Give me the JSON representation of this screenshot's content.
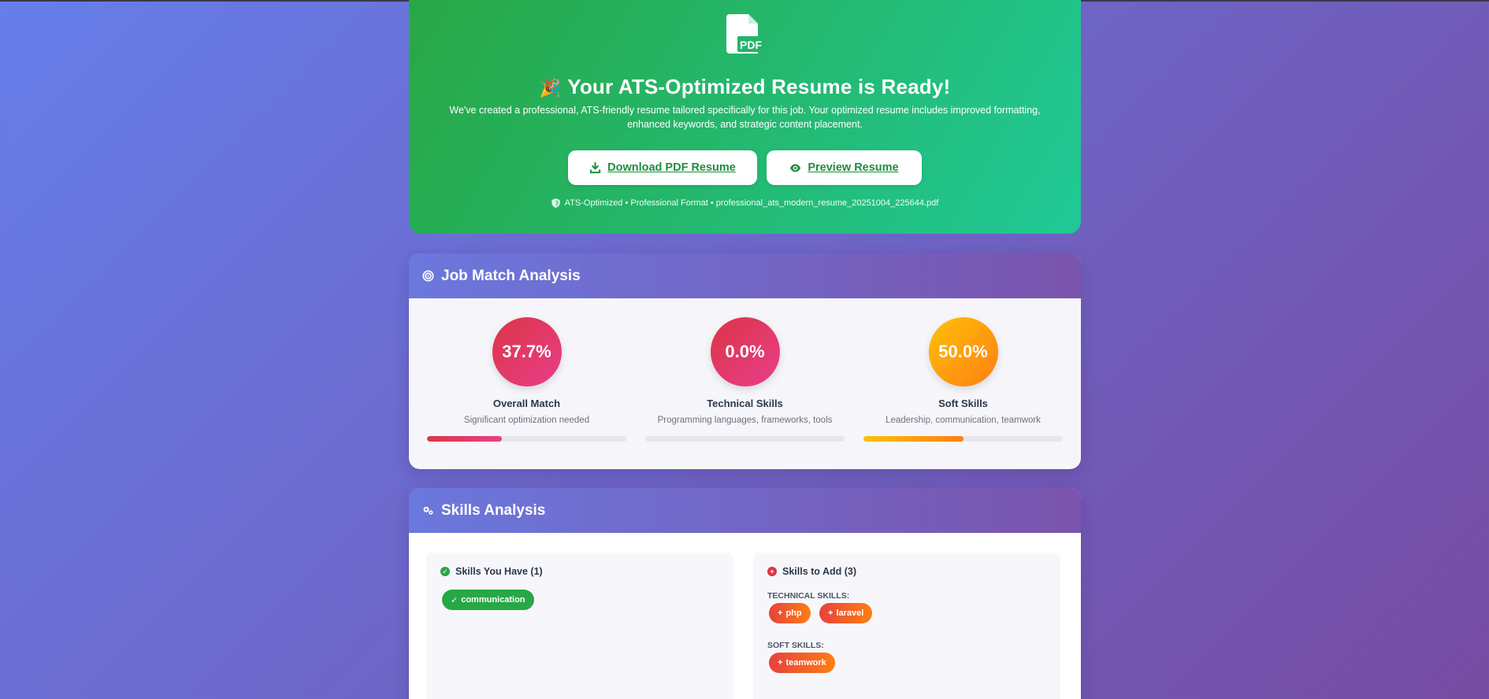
{
  "hero": {
    "icon": "pdf-file-icon",
    "icon_text": "PDF",
    "title_emoji": "🎉",
    "title": "Your ATS-Optimized Resume is Ready!",
    "description": "We've created a professional, ATS-friendly resume tailored specifically for this job. Your optimized resume includes improved formatting, enhanced keywords, and strategic content placement.",
    "download_label": "Download PDF Resume",
    "preview_label": "Preview Resume",
    "meta": "ATS-Optimized • Professional Format • professional_ats_modern_resume_20251004_225644.pdf"
  },
  "job_match": {
    "title": "Job Match Analysis",
    "icon": "target-icon",
    "metrics": [
      {
        "value": "37.7%",
        "percent": 37.7,
        "label": "Overall Match",
        "description": "Significant optimization needed",
        "level": "low"
      },
      {
        "value": "0.0%",
        "percent": 0.0,
        "label": "Technical Skills",
        "description": "Programming languages, frameworks, tools",
        "level": "low"
      },
      {
        "value": "50.0%",
        "percent": 50.0,
        "label": "Soft Skills",
        "description": "Leadership, communication, teamwork",
        "level": "mid"
      }
    ]
  },
  "skills": {
    "title": "Skills Analysis",
    "icon": "cogs-icon",
    "have_title": "Skills You Have (1)",
    "have": [
      "communication"
    ],
    "add_title": "Skills to Add (3)",
    "technical_label": "TECHNICAL SKILLS:",
    "technical": [
      "php",
      "laravel"
    ],
    "soft_label": "SOFT SKILLS:",
    "soft": [
      "teamwork"
    ]
  },
  "colors": {
    "success_green": "#28a745",
    "teal": "#20c997",
    "danger": "#dc3545",
    "warning": "#ffc107",
    "orange": "#fd7e14",
    "header_purple": "#764ba2",
    "header_blue": "#667eea"
  }
}
